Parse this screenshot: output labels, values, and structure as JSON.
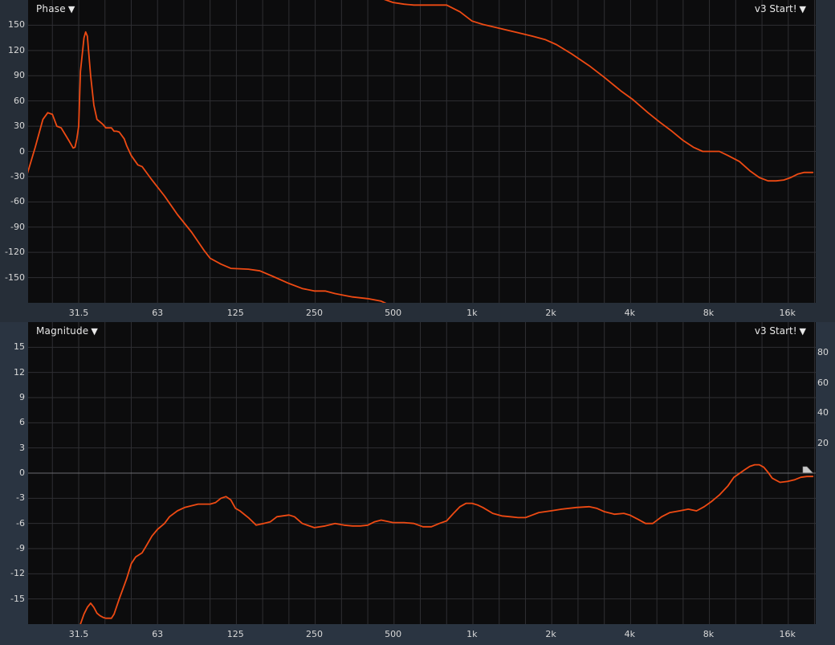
{
  "colors": {
    "curve": "#ee4a13",
    "plot_bg": "#0c0c0d",
    "grid": "#2f2f33",
    "text": "#d8d8d8"
  },
  "chart_data": [
    {
      "id": "phase",
      "type": "line",
      "title": "Phase",
      "title_arrow": "▼",
      "preset": "v3 Start!",
      "preset_arrow": "▼",
      "xscale": "log",
      "xlim": [
        20,
        20000
      ],
      "ylim": [
        -180,
        180
      ],
      "grid": true,
      "x_ticks": [
        {
          "value": 31.5,
          "label": "31.5"
        },
        {
          "value": 63,
          "label": "63"
        },
        {
          "value": 125,
          "label": "125"
        },
        {
          "value": 250,
          "label": "250"
        },
        {
          "value": 500,
          "label": "500"
        },
        {
          "value": 1000,
          "label": "1k"
        },
        {
          "value": 2000,
          "label": "2k"
        },
        {
          "value": 4000,
          "label": "4k"
        },
        {
          "value": 8000,
          "label": "8k"
        },
        {
          "value": 16000,
          "label": "16k"
        }
      ],
      "y_ticks": [
        {
          "value": 150,
          "label": "150"
        },
        {
          "value": 120,
          "label": "120"
        },
        {
          "value": 90,
          "label": "90"
        },
        {
          "value": 60,
          "label": "60"
        },
        {
          "value": 30,
          "label": "30"
        },
        {
          "value": 0,
          "label": "0"
        },
        {
          "value": -30,
          "label": "-30"
        },
        {
          "value": -60,
          "label": "-60"
        },
        {
          "value": -90,
          "label": "-90"
        },
        {
          "value": -120,
          "label": "-120"
        },
        {
          "value": -150,
          "label": "-150"
        }
      ],
      "series": [
        {
          "segments": [
            [
              [
                20,
                -28
              ],
              [
                21.5,
                5
              ],
              [
                23,
                38
              ],
              [
                24,
                46
              ],
              [
                25,
                44
              ],
              [
                26,
                30
              ],
              [
                27,
                28
              ],
              [
                28,
                20
              ],
              [
                29,
                12
              ],
              [
                30,
                4
              ],
              [
                30.5,
                5
              ],
              [
                31,
                15
              ],
              [
                31.5,
                30
              ],
              [
                32,
                95
              ],
              [
                33,
                135
              ],
              [
                33.5,
                142
              ],
              [
                34,
                137
              ],
              [
                35,
                90
              ],
              [
                36,
                55
              ],
              [
                37,
                38
              ],
              [
                38,
                35
              ],
              [
                39,
                32
              ],
              [
                40,
                28
              ],
              [
                41,
                28
              ],
              [
                42,
                28
              ],
              [
                43,
                24
              ],
              [
                44,
                24
              ],
              [
                45,
                23
              ],
              [
                47,
                15
              ],
              [
                48,
                7
              ],
              [
                50,
                -5
              ],
              [
                53,
                -16
              ],
              [
                55,
                -18
              ],
              [
                60,
                -34
              ],
              [
                67,
                -53
              ],
              [
                75,
                -75
              ],
              [
                85,
                -96
              ],
              [
                95,
                -118
              ],
              [
                100,
                -127
              ],
              [
                110,
                -134
              ],
              [
                120,
                -139
              ],
              [
                140,
                -140
              ],
              [
                155,
                -142
              ],
              [
                175,
                -149
              ],
              [
                200,
                -157
              ],
              [
                225,
                -163
              ],
              [
                250,
                -166
              ],
              [
                275,
                -166
              ],
              [
                300,
                -169
              ],
              [
                350,
                -173
              ],
              [
                400,
                -175
              ],
              [
                450,
                -178
              ],
              [
                480,
                -182
              ]
            ],
            [
              [
                460,
                181
              ],
              [
                500,
                177
              ],
              [
                550,
                175
              ],
              [
                600,
                174
              ],
              [
                700,
                174
              ],
              [
                800,
                174
              ],
              [
                900,
                166
              ],
              [
                1000,
                155
              ],
              [
                1100,
                151
              ],
              [
                1250,
                147
              ],
              [
                1500,
                141
              ],
              [
                1700,
                137
              ],
              [
                1900,
                133
              ],
              [
                2100,
                127
              ],
              [
                2400,
                116
              ],
              [
                2800,
                102
              ],
              [
                3200,
                88
              ],
              [
                3700,
                72
              ],
              [
                4100,
                62
              ],
              [
                4700,
                46
              ],
              [
                5200,
                35
              ],
              [
                5800,
                24
              ],
              [
                6400,
                13
              ],
              [
                7000,
                5
              ],
              [
                7600,
                0
              ],
              [
                8200,
                0
              ],
              [
                8800,
                0
              ],
              [
                9500,
                -5
              ],
              [
                10500,
                -12
              ],
              [
                11500,
                -23
              ],
              [
                12500,
                -31
              ],
              [
                13500,
                -35
              ],
              [
                14500,
                -35
              ],
              [
                15500,
                -34
              ],
              [
                16500,
                -31
              ],
              [
                17500,
                -27
              ],
              [
                18500,
                -25
              ],
              [
                20000,
                -25
              ]
            ]
          ]
        }
      ]
    },
    {
      "id": "magnitude",
      "type": "line",
      "title": "Magnitude",
      "title_arrow": "▼",
      "preset": "v3 Start!",
      "preset_arrow": "▼",
      "xscale": "log",
      "xlim": [
        20,
        20000
      ],
      "ylim": [
        -18,
        18
      ],
      "grid": true,
      "x_ticks": [
        {
          "value": 31.5,
          "label": "31.5"
        },
        {
          "value": 63,
          "label": "63"
        },
        {
          "value": 125,
          "label": "125"
        },
        {
          "value": 250,
          "label": "250"
        },
        {
          "value": 500,
          "label": "500"
        },
        {
          "value": 1000,
          "label": "1k"
        },
        {
          "value": 2000,
          "label": "2k"
        },
        {
          "value": 4000,
          "label": "4k"
        },
        {
          "value": 8000,
          "label": "8k"
        },
        {
          "value": 16000,
          "label": "16k"
        }
      ],
      "y_ticks": [
        {
          "value": 15,
          "label": "15"
        },
        {
          "value": 12,
          "label": "12"
        },
        {
          "value": 9,
          "label": "9"
        },
        {
          "value": 6,
          "label": "6"
        },
        {
          "value": 3,
          "label": "3"
        },
        {
          "value": 0,
          "label": "0"
        },
        {
          "value": -3,
          "label": "-3"
        },
        {
          "value": -6,
          "label": "-6"
        },
        {
          "value": -9,
          "label": "-9"
        },
        {
          "value": -12,
          "label": "-12"
        },
        {
          "value": -15,
          "label": "-15"
        }
      ],
      "y2_ticks": [
        {
          "value": 80,
          "label": "80"
        },
        {
          "value": 60,
          "label": "60"
        },
        {
          "value": 40,
          "label": "40"
        },
        {
          "value": 20,
          "label": "20"
        }
      ],
      "y2_fraction": [
        0.0,
        0.2,
        0.4,
        0.6,
        0.8
      ],
      "series": [
        {
          "segments": [
            [
              [
                32,
                -18
              ],
              [
                33,
                -16.8
              ],
              [
                34,
                -16
              ],
              [
                35,
                -15.5
              ],
              [
                36,
                -16
              ],
              [
                37,
                -16.7
              ],
              [
                38,
                -17
              ],
              [
                39,
                -17.2
              ],
              [
                40,
                -17.3
              ],
              [
                42,
                -17.3
              ],
              [
                43,
                -16.8
              ],
              [
                45,
                -15
              ],
              [
                48,
                -12.6
              ],
              [
                50,
                -10.8
              ],
              [
                52,
                -10
              ],
              [
                55,
                -9.5
              ],
              [
                57,
                -8.7
              ],
              [
                60,
                -7.5
              ],
              [
                63,
                -6.7
              ],
              [
                67,
                -6
              ],
              [
                70,
                -5.2
              ],
              [
                75,
                -4.5
              ],
              [
                80,
                -4.1
              ],
              [
                90,
                -3.7
              ],
              [
                100,
                -3.7
              ],
              [
                105,
                -3.5
              ],
              [
                110,
                -3
              ],
              [
                115,
                -2.8
              ],
              [
                120,
                -3.2
              ],
              [
                125,
                -4.2
              ],
              [
                130,
                -4.5
              ],
              [
                140,
                -5.3
              ],
              [
                150,
                -6.2
              ],
              [
                160,
                -6
              ],
              [
                170,
                -5.8
              ],
              [
                180,
                -5.2
              ],
              [
                200,
                -5
              ],
              [
                210,
                -5.2
              ],
              [
                225,
                -6
              ],
              [
                250,
                -6.5
              ],
              [
                275,
                -6.3
              ],
              [
                300,
                -6
              ],
              [
                325,
                -6.2
              ],
              [
                350,
                -6.3
              ],
              [
                375,
                -6.3
              ],
              [
                400,
                -6.2
              ],
              [
                425,
                -5.8
              ],
              [
                450,
                -5.6
              ],
              [
                500,
                -5.9
              ],
              [
                550,
                -5.9
              ],
              [
                600,
                -6
              ],
              [
                650,
                -6.4
              ],
              [
                700,
                -6.4
              ],
              [
                750,
                -6
              ],
              [
                800,
                -5.7
              ],
              [
                850,
                -4.8
              ],
              [
                900,
                -4
              ],
              [
                950,
                -3.6
              ],
              [
                1000,
                -3.6
              ],
              [
                1050,
                -3.8
              ],
              [
                1100,
                -4.1
              ],
              [
                1200,
                -4.8
              ],
              [
                1300,
                -5.1
              ],
              [
                1400,
                -5.2
              ],
              [
                1500,
                -5.3
              ],
              [
                1600,
                -5.3
              ],
              [
                1700,
                -5
              ],
              [
                1800,
                -4.7
              ],
              [
                2000,
                -4.5
              ],
              [
                2200,
                -4.3
              ],
              [
                2500,
                -4.1
              ],
              [
                2800,
                -4
              ],
              [
                3000,
                -4.2
              ],
              [
                3200,
                -4.6
              ],
              [
                3500,
                -4.9
              ],
              [
                3800,
                -4.8
              ],
              [
                4000,
                -5
              ],
              [
                4300,
                -5.5
              ],
              [
                4600,
                -6
              ],
              [
                4900,
                -6
              ],
              [
                5300,
                -5.2
              ],
              [
                5700,
                -4.7
              ],
              [
                6200,
                -4.5
              ],
              [
                6700,
                -4.3
              ],
              [
                7200,
                -4.5
              ],
              [
                7700,
                -4
              ],
              [
                8200,
                -3.4
              ],
              [
                8800,
                -2.6
              ],
              [
                9500,
                -1.5
              ],
              [
                10000,
                -0.5
              ],
              [
                11000,
                0.4
              ],
              [
                11500,
                0.8
              ],
              [
                12000,
                1
              ],
              [
                12500,
                1
              ],
              [
                13000,
                0.7
              ],
              [
                13500,
                0.1
              ],
              [
                14000,
                -0.6
              ],
              [
                15000,
                -1.1
              ],
              [
                16000,
                -1
              ],
              [
                17000,
                -0.8
              ],
              [
                18000,
                -0.5
              ],
              [
                19000,
                -0.4
              ],
              [
                20000,
                -0.4
              ]
            ]
          ]
        }
      ]
    }
  ]
}
